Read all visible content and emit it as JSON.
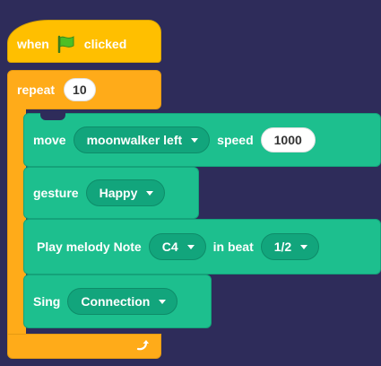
{
  "hat": {
    "when": "when",
    "clicked": "clicked"
  },
  "repeat": {
    "label": "repeat",
    "count": "10"
  },
  "move": {
    "label": "move",
    "target": "moonwalker left",
    "speed_label": "speed",
    "speed": "1000"
  },
  "gesture": {
    "label": "gesture",
    "value": "Happy"
  },
  "melody": {
    "label": "Play melody Note",
    "note": "C4",
    "beat_label": "in beat",
    "beat": "1/2"
  },
  "sing": {
    "label": "Sing",
    "value": "Connection"
  },
  "colors": {
    "background": "#2e2c5a",
    "events": "#ffbf00",
    "control": "#ffab19",
    "extension": "#1dbf8e"
  }
}
